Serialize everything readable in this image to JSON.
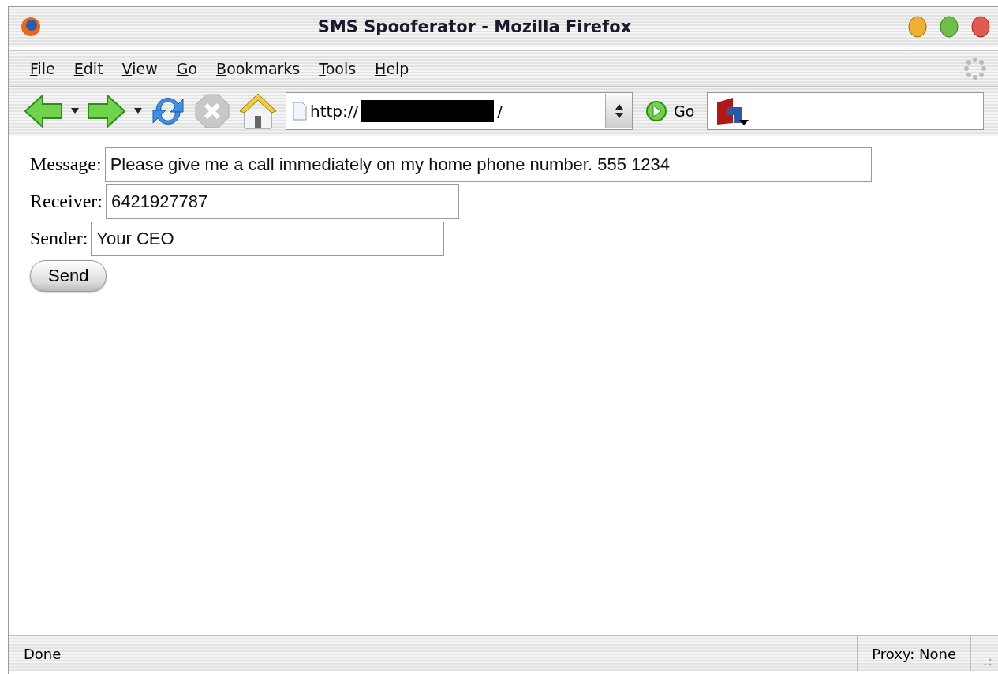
{
  "window": {
    "title": "SMS Spooferator - Mozilla Firefox"
  },
  "menu": [
    "File",
    "Edit",
    "View",
    "Go",
    "Bookmarks",
    "Tools",
    "Help"
  ],
  "toolbar": {
    "url_prefix": "http://",
    "url_suffix": "/",
    "go_label": "Go"
  },
  "form": {
    "fields": [
      {
        "label": "Message:",
        "value": "Please give me a call immediately on my home phone number. 555 1234",
        "kind": "wide"
      },
      {
        "label": "Receiver:",
        "value": "6421927787",
        "kind": "normal"
      },
      {
        "label": "Sender:",
        "value": "Your CEO",
        "kind": "normal"
      }
    ],
    "button": "Send"
  },
  "status_bar": {
    "text": "Done",
    "proxy": "Proxy: None"
  }
}
